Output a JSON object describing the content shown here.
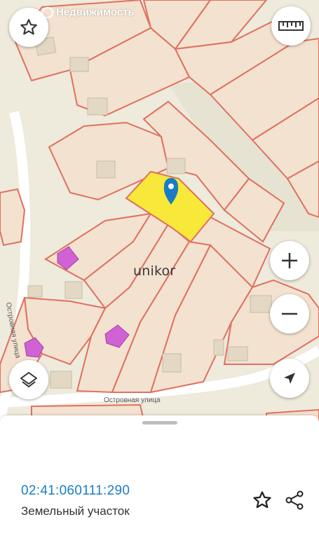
{
  "map": {
    "watermark": "Недвижимость",
    "brand": "unikor",
    "street_bottom": "Островная улица",
    "street_left": "Островная улица"
  },
  "controls": {
    "favorite_icon": "star-outline-icon",
    "ruler_icon": "ruler-icon",
    "zoom_in_icon": "plus-icon",
    "zoom_out_icon": "minus-icon",
    "layers_icon": "layers-icon",
    "locate_icon": "navigation-arrow-icon"
  },
  "sheet": {
    "cadastral_number": "02:41:060111:290",
    "parcel_type": "Земельный участок",
    "favorite_icon": "star-outline-icon",
    "share_icon": "share-icon"
  },
  "colors": {
    "parcel_border": "#e07060",
    "parcel_fill": "#f3e2cf",
    "selected_fill": "#f7e83a",
    "building_magenta": "#d062d4",
    "pin": "#1a7cc4"
  }
}
